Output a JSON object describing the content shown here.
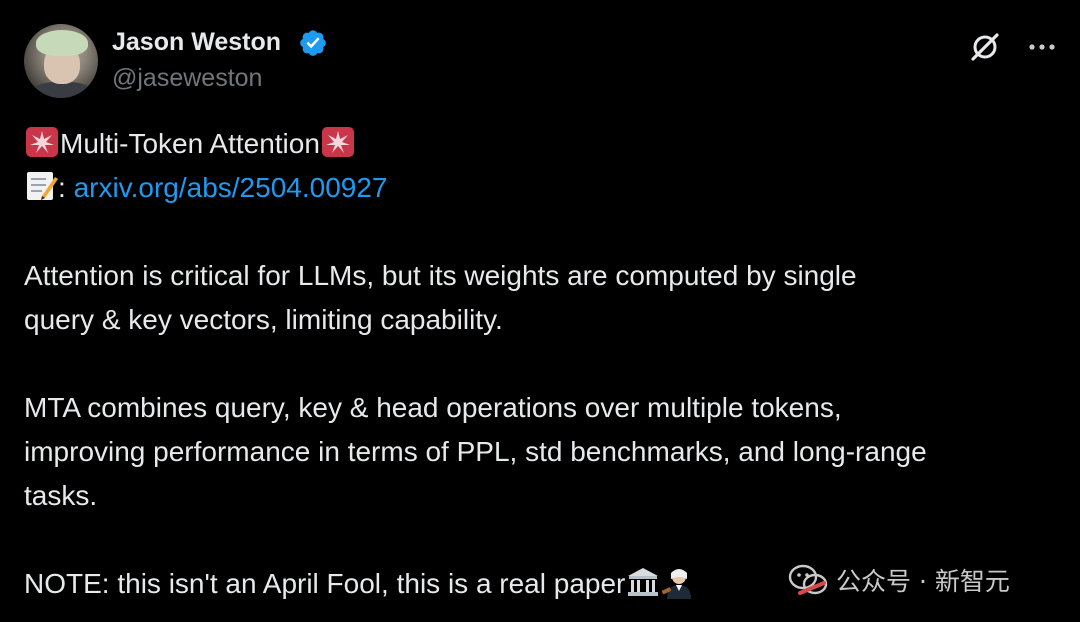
{
  "author": {
    "name": "Jason Weston",
    "handle": "@jaseweston"
  },
  "icons": {
    "verified": "verified-badge-icon",
    "grok": "grok-icon",
    "more": "more-options-icon"
  },
  "colors": {
    "background": "#000000",
    "text": "#e7e9ea",
    "secondary": "#71767b",
    "link": "#1d9bf0",
    "verified": "#1d9bf0"
  },
  "tweet": {
    "title": "Multi-Token Attention",
    "link_prefix": ":",
    "link": "arxiv.org/abs/2504.00927",
    "para1_line1": "Attention is critical for LLMs, but its weights are computed by single",
    "para1_line2": "query & key vectors, limiting capability.",
    "para2_line1": "MTA combines query, key & head operations over multiple tokens,",
    "para2_line2": "improving performance in terms of PPL, std benchmarks, and long-range",
    "para2_line3": "tasks.",
    "note": "NOTE: this isn't an April Fool, this is a real paper"
  },
  "watermark": {
    "text": "公众号 · 新智元"
  }
}
